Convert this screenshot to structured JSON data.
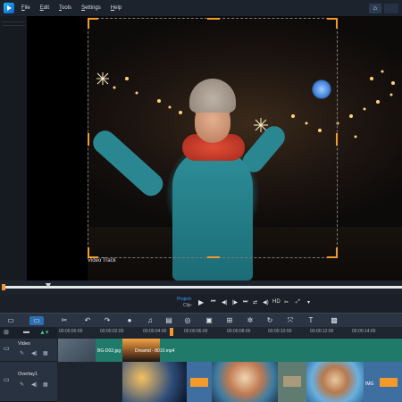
{
  "menu": {
    "items": [
      {
        "label": "File",
        "ul": "F",
        "rest": "ile"
      },
      {
        "label": "Edit",
        "ul": "E",
        "rest": "dit"
      },
      {
        "label": "Tools",
        "ul": "T",
        "rest": "ools"
      },
      {
        "label": "Settings",
        "ul": "S",
        "rest": "ettings"
      },
      {
        "label": "Help",
        "ul": "H",
        "rest": "elp"
      }
    ]
  },
  "preview": {
    "frame_label": "Video Track"
  },
  "playback": {
    "mode_project": "Project-",
    "mode_clip": "Clip-",
    "hd_label": "HD"
  },
  "ruler": {
    "ticks": [
      "00:00:00:00",
      "00:00:02:00",
      "00:00:04:00",
      "00:00:06:00",
      "00:00:08:00",
      "00:00:10:00",
      "00:00:12:00",
      "00:00:14:00"
    ]
  },
  "tracks": {
    "video": {
      "name": "Video",
      "clip1_label": "BG-D02.jpg",
      "clip2_label": "Dreamd - 8010.mp4"
    },
    "overlay": {
      "name": "Overlay1",
      "clip_label": "IMG"
    }
  },
  "colors": {
    "accent": "#f39a2b",
    "selection_blue": "#2d6fb3",
    "video_clip_green": "#1f7a6a",
    "overlay_clip_blue": "#3f6fa0"
  }
}
